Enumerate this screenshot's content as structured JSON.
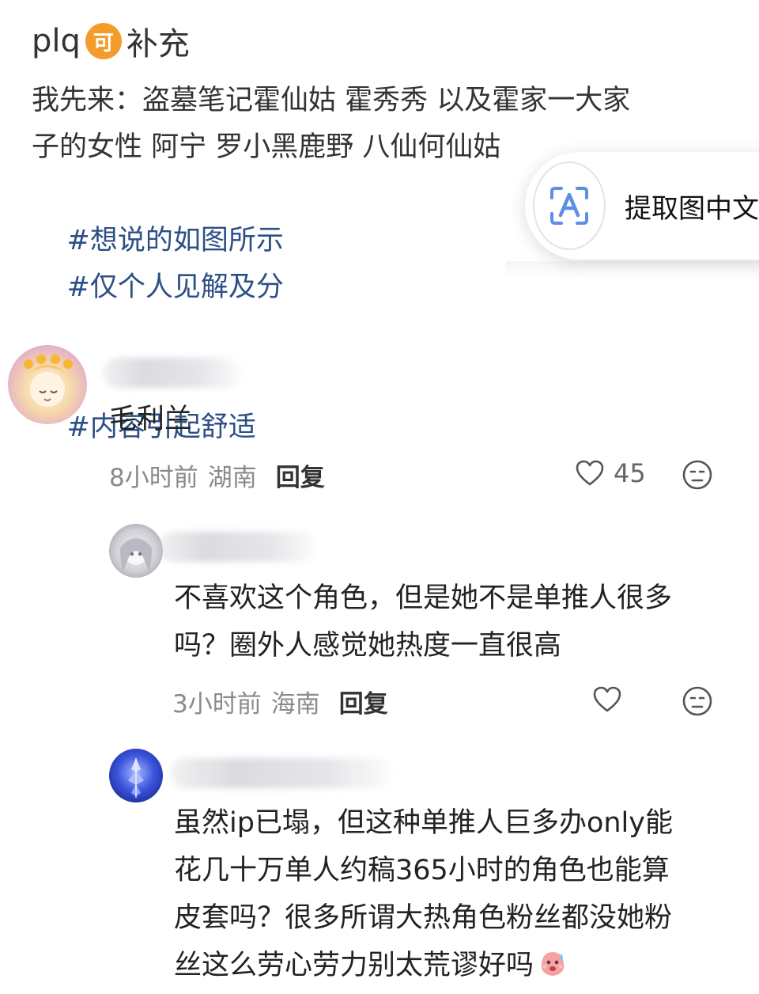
{
  "post": {
    "user": "plq",
    "badge": "可",
    "title_suffix": "补充",
    "body": "我先来：盗墓笔记霍仙姑 霍秀秀 以及霍家一大家\n子的女性 阿宁 罗小黑鹿野 八仙何仙姑",
    "tags_line1": [
      "#想说的如图所示",
      "#仅个人见解及分"
    ],
    "tags_line2": [
      "#内容引起舒适"
    ]
  },
  "ocr_button": {
    "label": "提取图中文字",
    "icon": "text-recognition-icon"
  },
  "comments": [
    {
      "text": "毛利兰",
      "time": "8小时前",
      "location": "湖南",
      "reply_label": "回复",
      "likes": "45"
    },
    {
      "text": "不喜欢这个角色，但是她不是单推人很多\n吗？圈外人感觉她热度一直很高",
      "time": "3小时前",
      "location": "海南",
      "reply_label": "回复",
      "likes": ""
    },
    {
      "text": "虽然ip已塌，但这种单推人巨多办only能\n花几十万单人约稿365小时的角色也能算\n皮套吗？很多所谓大热角色粉丝都没她粉\n丝这么劳心劳力别太荒谬好吗"
    }
  ],
  "colors": {
    "tag": "#2c4f86",
    "badge": "#f39c2b",
    "meta": "#8a8a8a"
  }
}
